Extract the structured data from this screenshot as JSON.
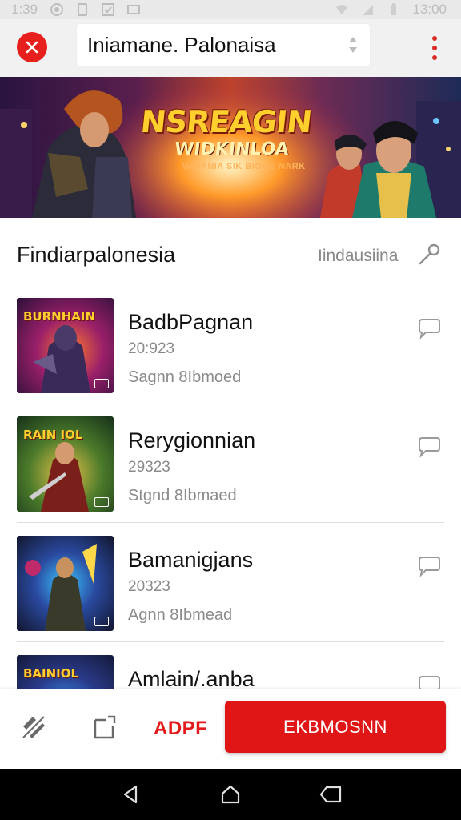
{
  "status_bar": {
    "time_left": "1:39",
    "time_right": "13:00"
  },
  "app_bar": {
    "search_value": "Iniamane. Palonaisa"
  },
  "banner": {
    "title": "NSREAGIN",
    "subtitle": "WIDKINLOA",
    "tagline": "WIDANIA SIK BIOOE NARK"
  },
  "section": {
    "title": "Findiarpalonesia",
    "filter_label": "Iindausiina"
  },
  "items": [
    {
      "title": "BadbPagnan",
      "number": "20:923",
      "meta": "Sagnn 8Ibmoed",
      "thumb_text": "BURNHAIN"
    },
    {
      "title": "Rerygionnian",
      "number": "29323",
      "meta": "Stgnd 8Ibmaed",
      "thumb_text": "RAIN IOL"
    },
    {
      "title": "Bamanigjans",
      "number": "20323",
      "meta": "Agnn 8Ibmead",
      "thumb_text": ""
    },
    {
      "title": "Amlain/.anba",
      "number": "",
      "meta": "",
      "thumb_text": "BAINIOL"
    }
  ],
  "action_bar": {
    "link_label": "ADPF",
    "primary_label": "EKBMOSNN"
  },
  "colors": {
    "accent": "#e01515",
    "status_bg": "#e9e9e9",
    "app_bar_bg": "#f1f1f1"
  },
  "icons": {
    "close": "close-icon",
    "more": "more-vert-icon",
    "sort": "sort-icon",
    "filter": "wrench-icon",
    "comment": "comment-icon",
    "edit": "edit-off-icon",
    "share": "share-icon",
    "back": "back-icon",
    "home": "home-icon",
    "recents": "recents-icon"
  }
}
